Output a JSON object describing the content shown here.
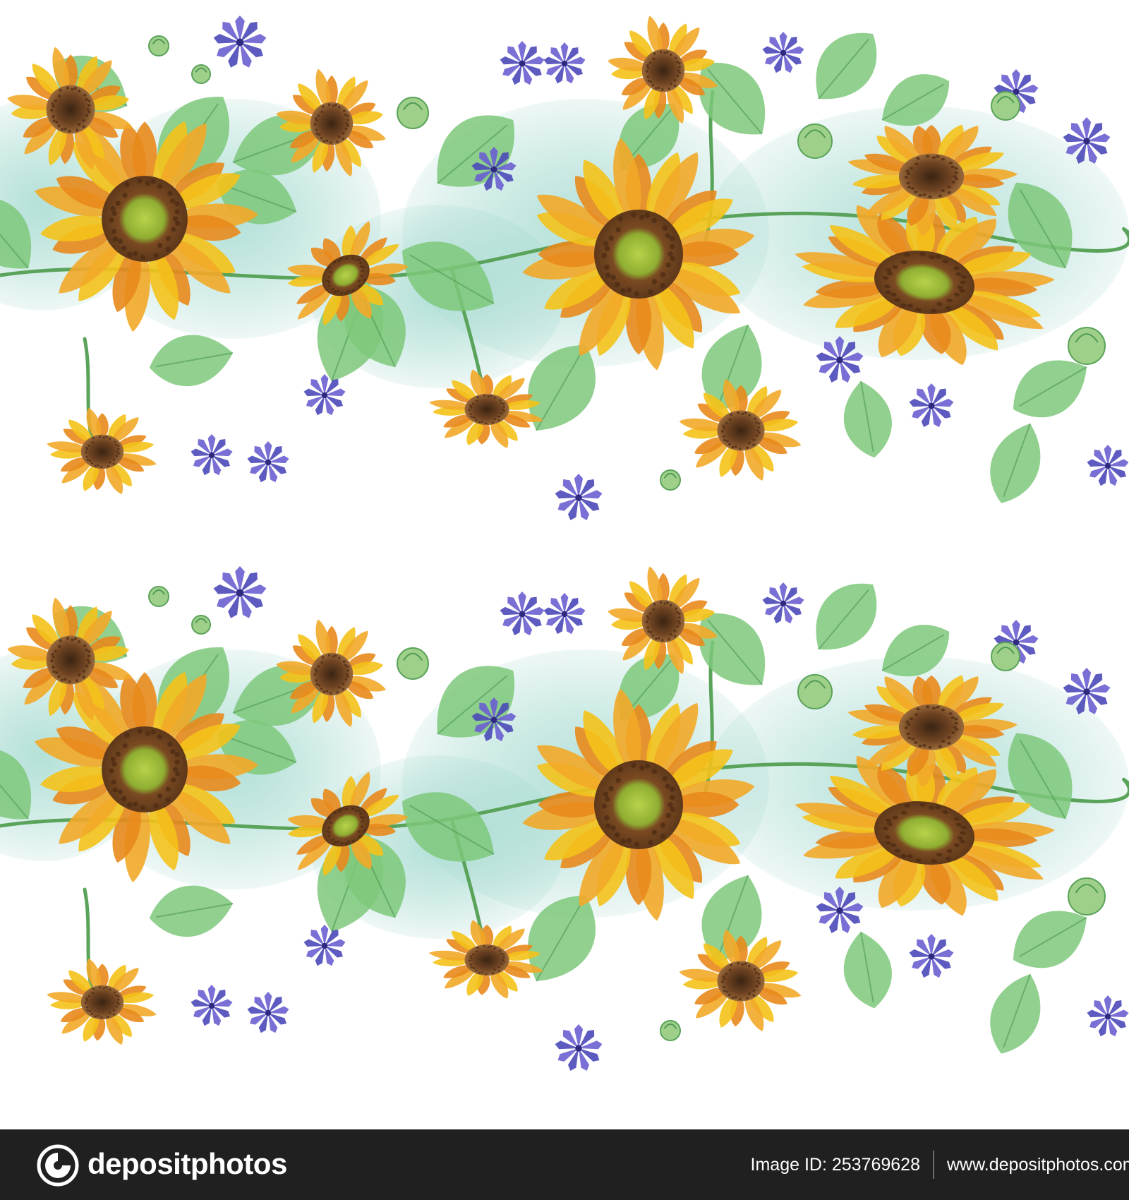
{
  "colors": {
    "footer_background": "#202020",
    "footer_text": "#ffffff",
    "petal_yellow": "#f4c21a",
    "petal_orange": "#e8891c",
    "seed_brown": "#7a4a22",
    "center_green": "#a6c43a",
    "leaf_green": "#7ec87a",
    "wash_aqua": "#8fcfc4",
    "cornflower_blue": "#4b49b8"
  },
  "footer": {
    "brand": "depositphotos",
    "image_id": "Image ID: 253769628",
    "site": "www.depositphotos.com"
  },
  "icons": {
    "logo": "depositphotos-logo-icon"
  }
}
